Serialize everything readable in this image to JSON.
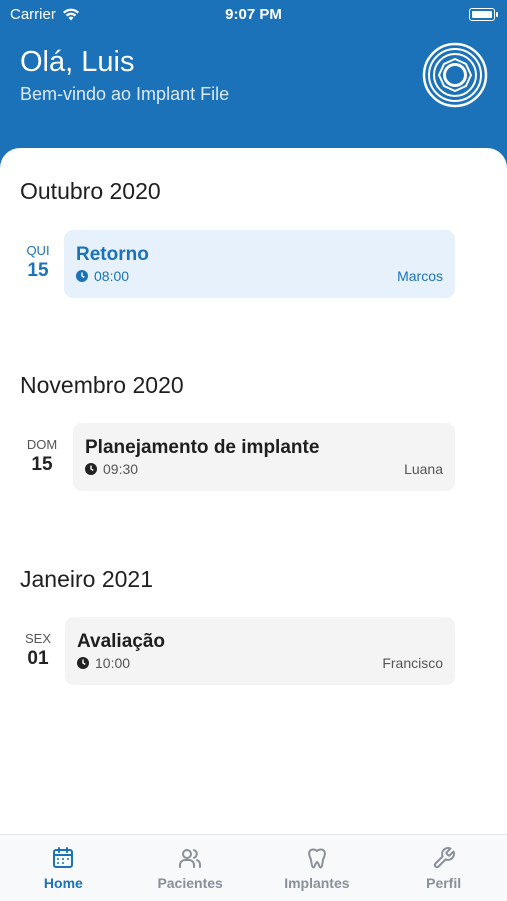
{
  "status_bar": {
    "carrier": "Carrier",
    "time": "9:07 PM"
  },
  "header": {
    "greeting": "Olá, Luis",
    "subtitle": "Bem-vindo ao Implant File"
  },
  "colors": {
    "primary": "#1c72b8",
    "highlight_card": "#e6f1fb",
    "card": "#f4f4f4"
  },
  "schedule": [
    {
      "month": "Outubro 2020",
      "weekday": "QUI",
      "day": "15",
      "title": "Retorno",
      "time": "08:00",
      "person": "Marcos",
      "highlighted": true
    },
    {
      "month": "Novembro 2020",
      "weekday": "DOM",
      "day": "15",
      "title": "Planejamento de implante",
      "time": "09:30",
      "person": "Luana",
      "highlighted": false
    },
    {
      "month": "Janeiro 2021",
      "weekday": "SEX",
      "day": "01",
      "title": "Avaliação",
      "time": "10:00",
      "person": "Francisco",
      "highlighted": false
    }
  ],
  "tabs": [
    {
      "label": "Home",
      "icon": "calendar-icon",
      "active": true
    },
    {
      "label": "Pacientes",
      "icon": "users-icon",
      "active": false
    },
    {
      "label": "Implantes",
      "icon": "tooth-icon",
      "active": false
    },
    {
      "label": "Perfil",
      "icon": "wrench-icon",
      "active": false
    }
  ]
}
